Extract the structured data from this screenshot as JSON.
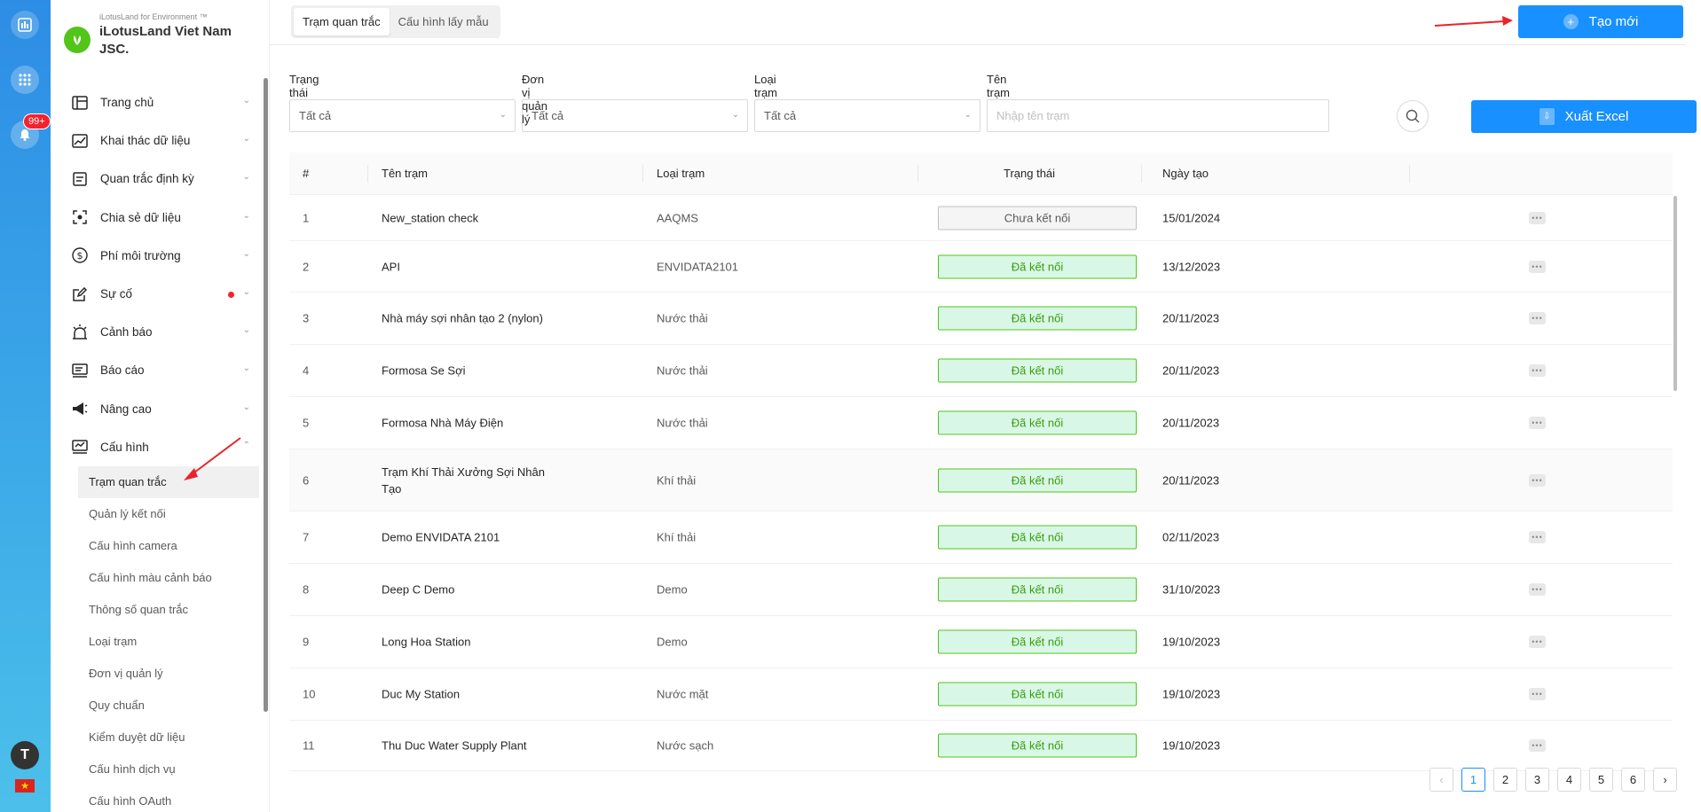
{
  "rail": {
    "notification_count": "99+",
    "avatar_letter": "T"
  },
  "org": {
    "subtitle": "iLotusLand for Environment ™",
    "name": "iLotusLand Viet Nam JSC."
  },
  "menu": [
    {
      "label": "Trang chủ",
      "icon": "home-icon"
    },
    {
      "label": "Khai thác dữ liệu",
      "icon": "chart-icon"
    },
    {
      "label": "Quan trắc định kỳ",
      "icon": "document-icon"
    },
    {
      "label": "Chia sẻ dữ liệu",
      "icon": "share-icon"
    },
    {
      "label": "Phí môi trường",
      "icon": "dollar-icon"
    },
    {
      "label": "Sự cố",
      "icon": "edit-icon"
    },
    {
      "label": "Cảnh báo",
      "icon": "alarm-icon"
    },
    {
      "label": "Báo cáo",
      "icon": "report-icon"
    },
    {
      "label": "Nâng cao",
      "icon": "megaphone-icon"
    },
    {
      "label": "Cấu hình",
      "icon": "config-icon"
    }
  ],
  "submenu": [
    "Trạm quan trắc",
    "Quản lý kết nối",
    "Cấu hình camera",
    "Cấu hình màu cảnh báo",
    "Thông số quan trắc",
    "Loại trạm",
    "Đơn vị quản lý",
    "Quy chuẩn",
    "Kiểm duyệt dữ liệu",
    "Cấu hình dịch vụ",
    "Cấu hình OAuth"
  ],
  "tabs": [
    "Trạm quan trắc",
    "Cấu hình lấy mẫu"
  ],
  "create_button": "Tạo mới",
  "filters": {
    "status_label": "Trạng thái",
    "status_value": "Tất cả",
    "unit_label": "Đơn vị quản lý",
    "unit_value": "Tất cả",
    "type_label": "Loại trạm",
    "type_value": "Tất cả",
    "name_label": "Tên trạm",
    "name_placeholder": "Nhập tên trạm"
  },
  "export_button": "Xuất Excel",
  "table": {
    "headers": [
      "#",
      "Tên trạm",
      "Loại trạm",
      "Trạng thái",
      "Ngày tạo"
    ],
    "rows": [
      {
        "num": "1",
        "name": "New_station check",
        "type": "AAQMS",
        "status": "Chưa kết nối",
        "connected": false,
        "date": "15/01/2024"
      },
      {
        "num": "2",
        "name": "API",
        "type": "ENVIDATA2101",
        "status": "Đã kết nối",
        "connected": true,
        "date": "13/12/2023"
      },
      {
        "num": "3",
        "name": "Nhà máy sợi nhân tạo 2 (nylon)",
        "type": "Nước thải",
        "status": "Đã kết nối",
        "connected": true,
        "date": "20/11/2023"
      },
      {
        "num": "4",
        "name": "Formosa Se Sợi",
        "type": "Nước thải",
        "status": "Đã kết nối",
        "connected": true,
        "date": "20/11/2023"
      },
      {
        "num": "5",
        "name": "Formosa Nhà Máy Điện",
        "type": "Nước thải",
        "status": "Đã kết nối",
        "connected": true,
        "date": "20/11/2023"
      },
      {
        "num": "6",
        "name": "Trạm Khí Thải Xưởng Sợi Nhân Tạo",
        "type": "Khí thải",
        "status": "Đã kết nối",
        "connected": true,
        "date": "20/11/2023"
      },
      {
        "num": "7",
        "name": "Demo ENVIDATA 2101",
        "type": "Khí thải",
        "status": "Đã kết nối",
        "connected": true,
        "date": "02/11/2023"
      },
      {
        "num": "8",
        "name": "Deep C Demo",
        "type": "Demo",
        "status": "Đã kết nối",
        "connected": true,
        "date": "31/10/2023"
      },
      {
        "num": "9",
        "name": "Long Hoa Station",
        "type": "Demo",
        "status": "Đã kết nối",
        "connected": true,
        "date": "19/10/2023"
      },
      {
        "num": "10",
        "name": "Duc My Station",
        "type": "Nước mặt",
        "status": "Đã kết nối",
        "connected": true,
        "date": "19/10/2023"
      },
      {
        "num": "11",
        "name": "Thu Duc Water Supply Plant",
        "type": "Nước sạch",
        "status": "Đã kết nối",
        "connected": true,
        "date": "19/10/2023"
      }
    ]
  },
  "pagination": {
    "pages": [
      "1",
      "2",
      "3",
      "4",
      "5",
      "6"
    ],
    "current": "1"
  },
  "colors": {
    "primary": "#1890ff",
    "connected_bg": "#d9f7e6",
    "connected_text": "#389e0d",
    "annotation_arrow": "#e8252a"
  }
}
